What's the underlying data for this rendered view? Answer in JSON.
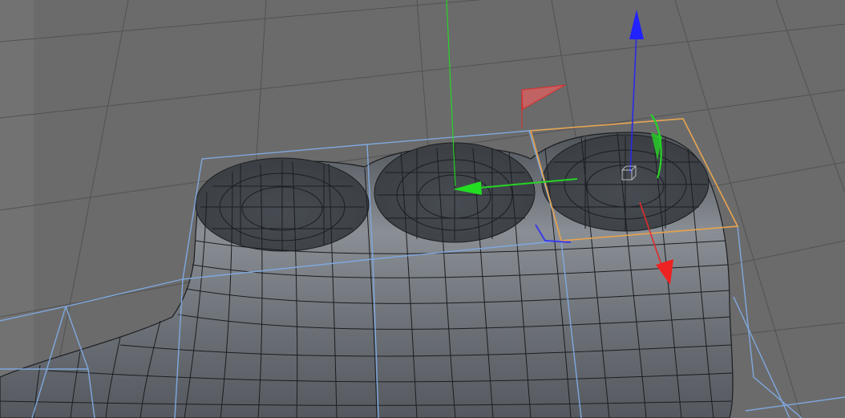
{
  "viewport": {
    "colors": {
      "background": "#6b6b6b",
      "grid": "#525252",
      "mesh_surface": "#5a5f66",
      "mesh_wire": "#1b1d20",
      "cage_wire": "#7fa8de",
      "selection_box": "#e8a24a",
      "axis_x": "#e02a2a",
      "axis_y": "#27d327",
      "axis_z": "#2a2ae8"
    },
    "icons": [
      "move-gizmo-icon",
      "rotate-handle-icon",
      "scale-handle-icon",
      "object-center-icon"
    ]
  }
}
